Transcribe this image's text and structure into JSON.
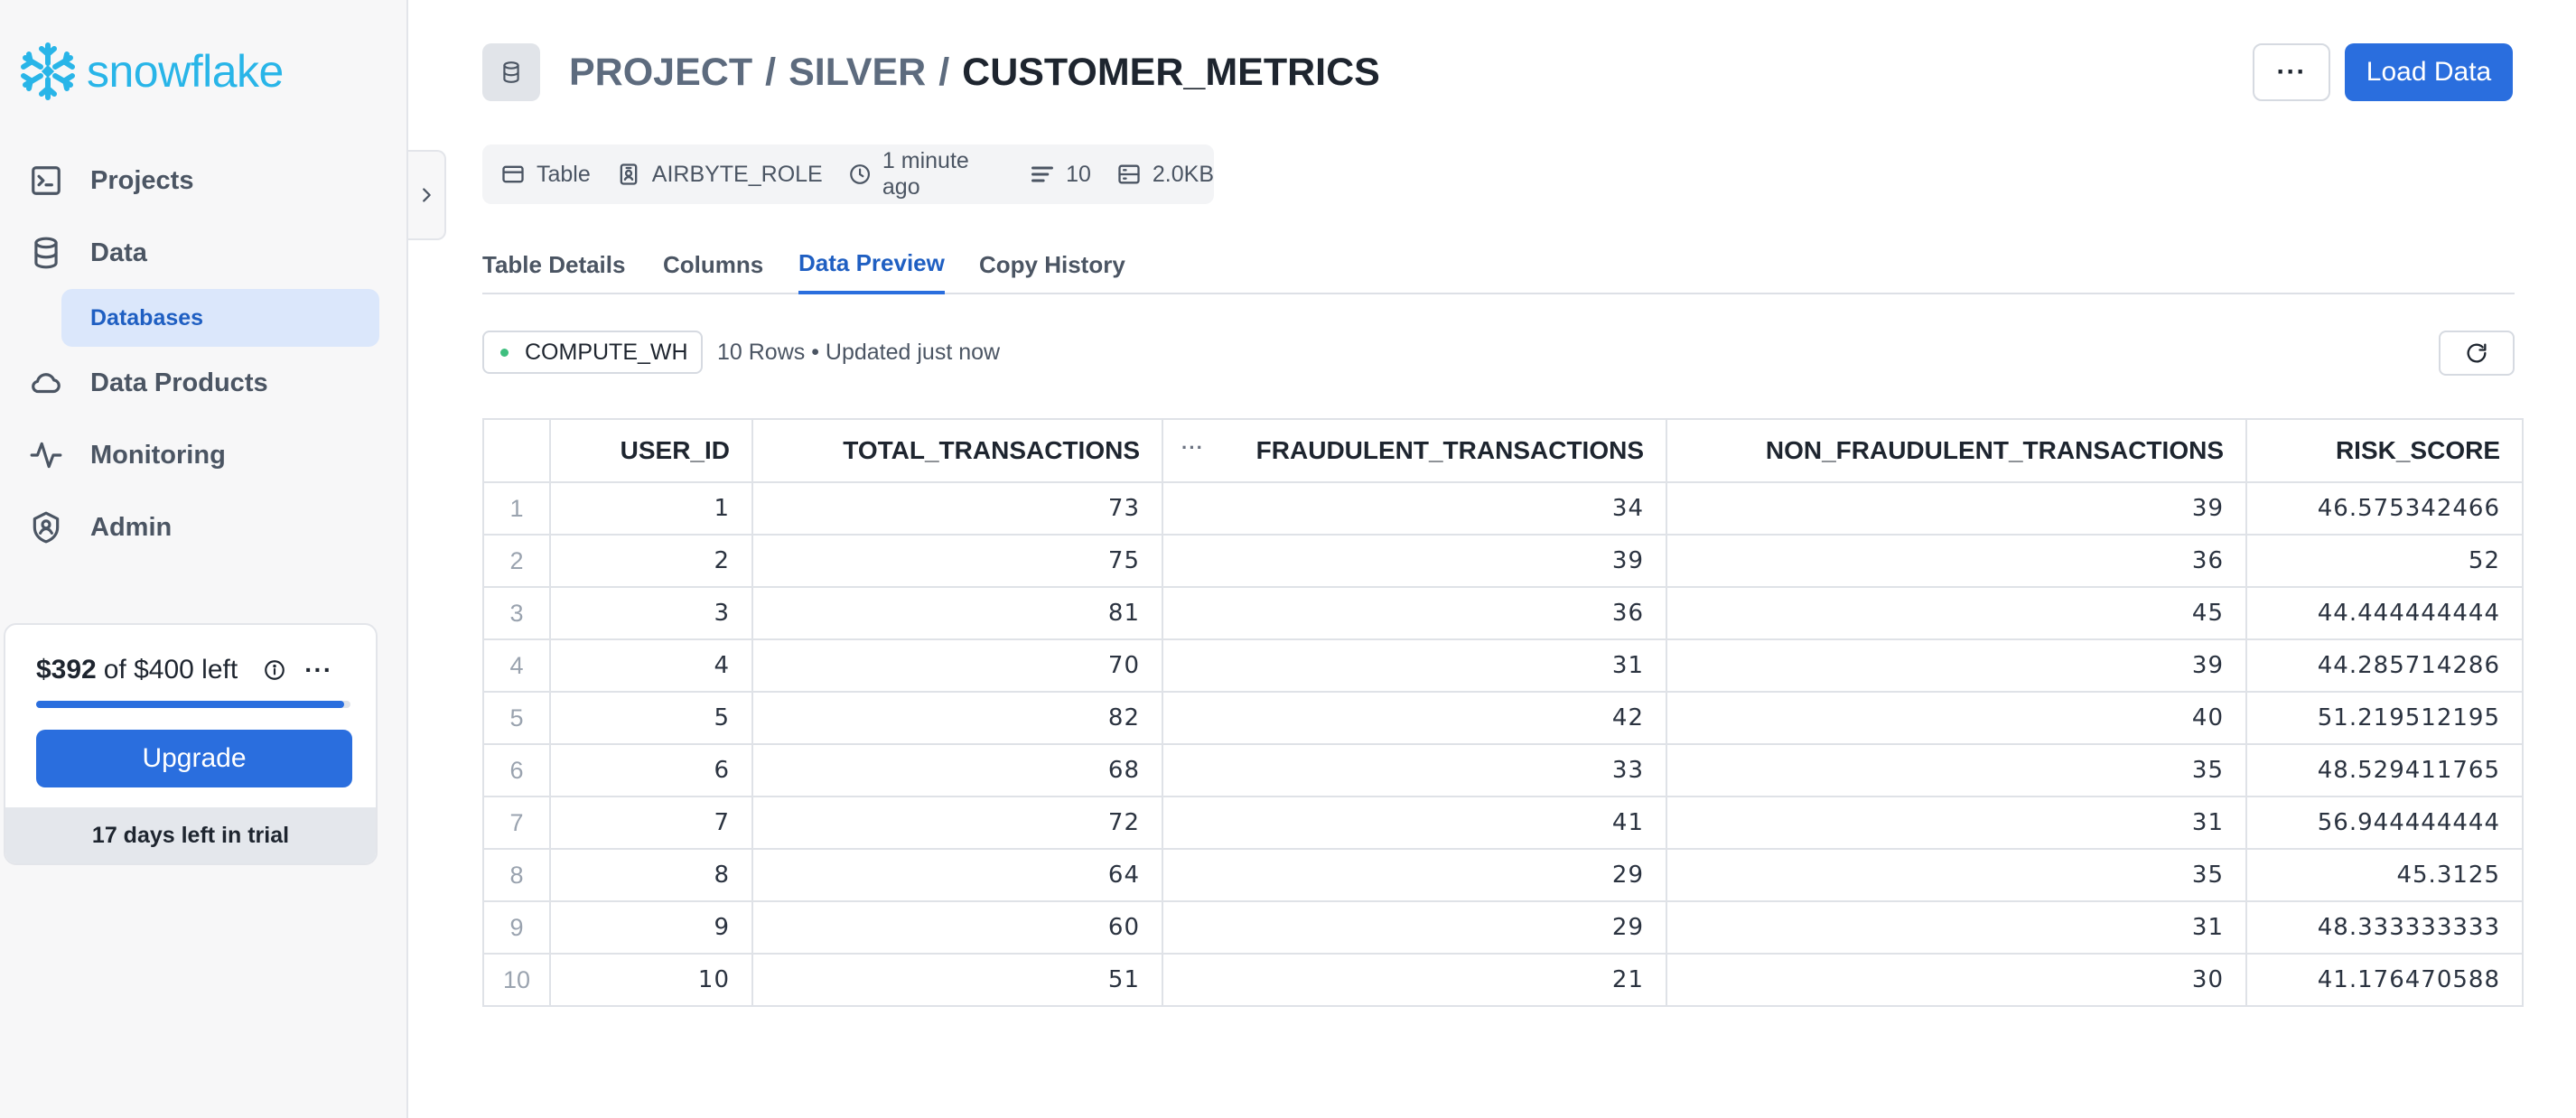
{
  "sidebar": {
    "logo_text": "snowflake",
    "items": [
      {
        "label": "Projects",
        "icon": "terminal-icon"
      },
      {
        "label": "Data",
        "icon": "database-icon"
      },
      {
        "label": "Data Products",
        "icon": "cloud-icon"
      },
      {
        "label": "Monitoring",
        "icon": "activity-icon"
      },
      {
        "label": "Admin",
        "icon": "shield-icon"
      }
    ],
    "sub_item": "Databases",
    "credits": {
      "amount": "$392",
      "rest": "of $400 left",
      "remaining_fraction": 0.98,
      "upgrade_label": "Upgrade",
      "trial_text": "17 days left in trial"
    }
  },
  "header": {
    "breadcrumb": [
      "PROJECT",
      "SILVER",
      "CUSTOMER_METRICS"
    ],
    "separator": "/",
    "more_label": "···",
    "load_label": "Load Data"
  },
  "meta": {
    "type": "Table",
    "role": "AIRBYTE_ROLE",
    "updated": "1 minute ago",
    "rows": "10",
    "size": "2.0KB"
  },
  "tabs": [
    "Table Details",
    "Columns",
    "Data Preview",
    "Copy History"
  ],
  "active_tab": "Data Preview",
  "preview": {
    "warehouse": "COMPUTE_WH",
    "info": "10 Rows • Updated just now"
  },
  "table": {
    "columns": [
      "USER_ID",
      "TOTAL_TRANSACTIONS",
      "FRAUDULENT_TRANSACTIONS",
      "NON_FRAUDULENT_TRANSACTIONS",
      "RISK_SCORE"
    ],
    "column_menu": "···",
    "rows": [
      [
        "1",
        "1",
        "73",
        "34",
        "39",
        "46.575342466"
      ],
      [
        "2",
        "2",
        "75",
        "39",
        "36",
        "52"
      ],
      [
        "3",
        "3",
        "81",
        "36",
        "45",
        "44.444444444"
      ],
      [
        "4",
        "4",
        "70",
        "31",
        "39",
        "44.285714286"
      ],
      [
        "5",
        "5",
        "82",
        "42",
        "40",
        "51.219512195"
      ],
      [
        "6",
        "6",
        "68",
        "33",
        "35",
        "48.529411765"
      ],
      [
        "7",
        "7",
        "72",
        "41",
        "31",
        "56.944444444"
      ],
      [
        "8",
        "8",
        "64",
        "29",
        "35",
        "45.3125"
      ],
      [
        "9",
        "9",
        "60",
        "29",
        "31",
        "48.333333333"
      ],
      [
        "10",
        "10",
        "51",
        "21",
        "30",
        "41.176470588"
      ]
    ]
  },
  "colors": {
    "accent": "#2a6ede",
    "brand": "#29b5e8",
    "status_ok": "#3fbf7f"
  }
}
